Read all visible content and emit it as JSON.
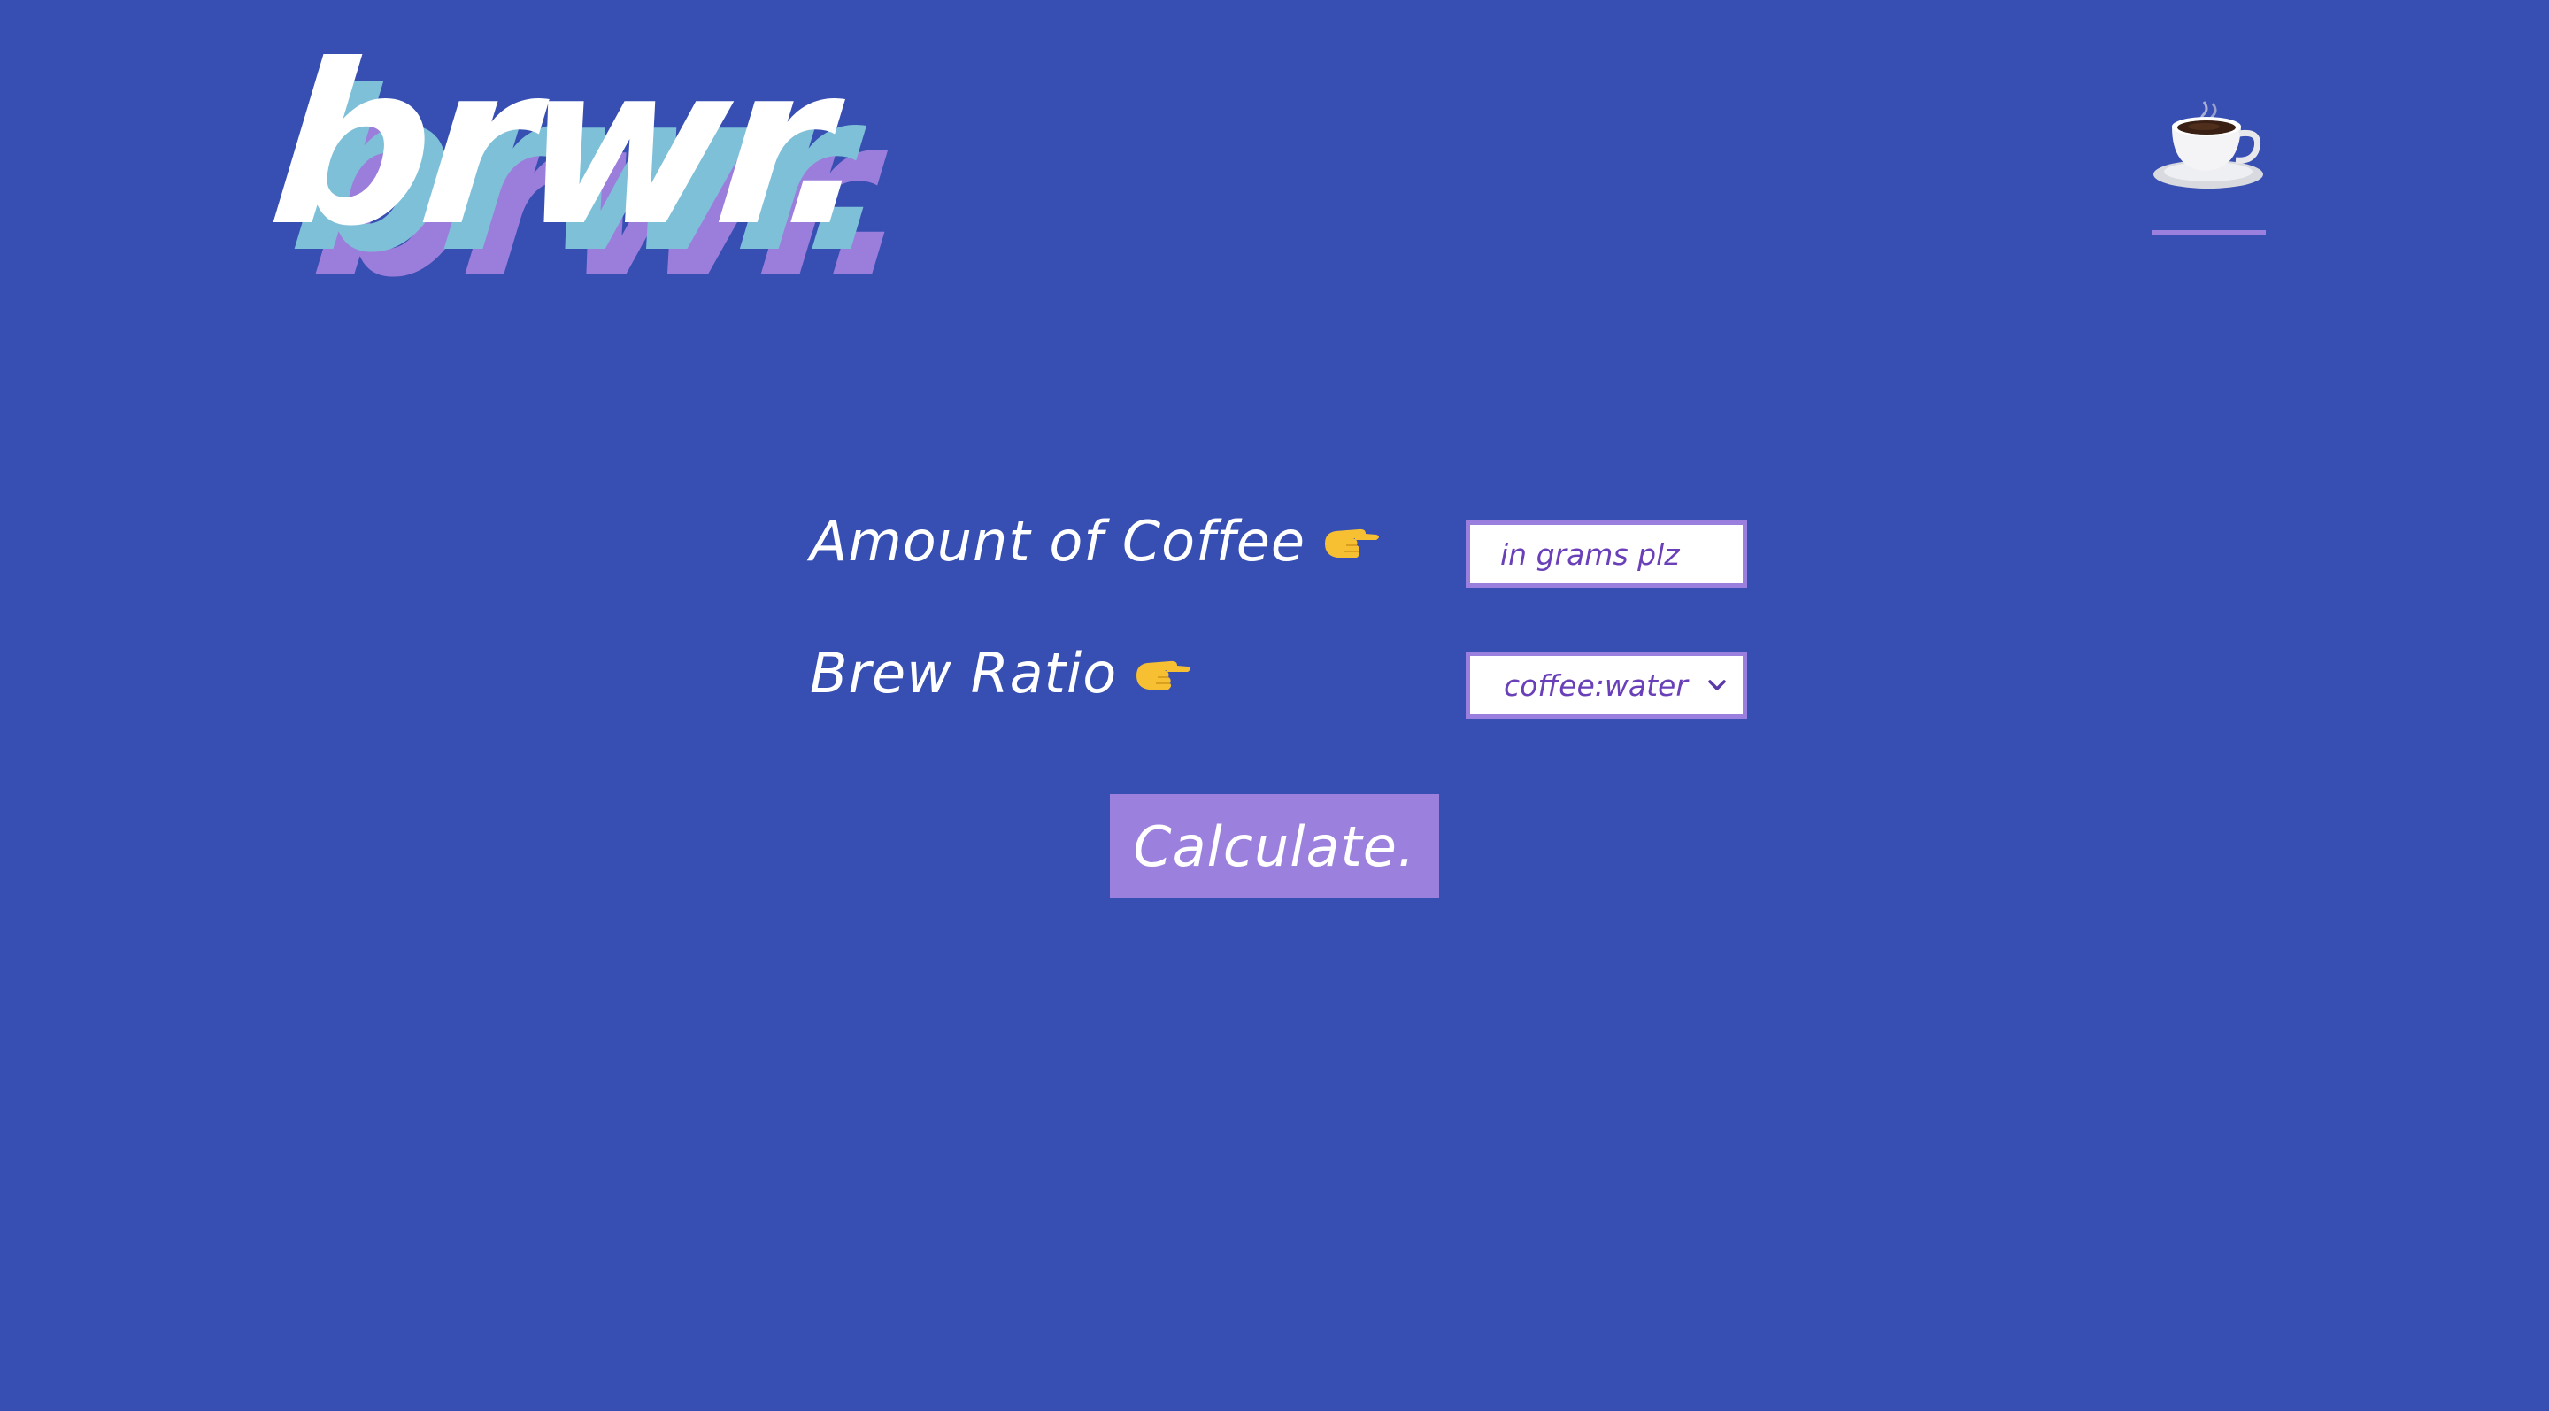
{
  "header": {
    "logo_text": "brwr.",
    "logo_colors": [
      "#ffffff",
      "#7fc0d9",
      "#9b7edb"
    ],
    "nav_icon": "coffee-cup-icon"
  },
  "form": {
    "coffee_label": "Amount of Coffee",
    "coffee_placeholder": "in grams plz",
    "ratio_label": "Brew Ratio",
    "ratio_selected": "coffee:water",
    "pointer_icon": "pointing-hand-icon",
    "calculate_label": "Calculate."
  },
  "colors": {
    "background": "#374eb2",
    "accent": "#9b80dd",
    "input_text": "#6a40b8"
  }
}
